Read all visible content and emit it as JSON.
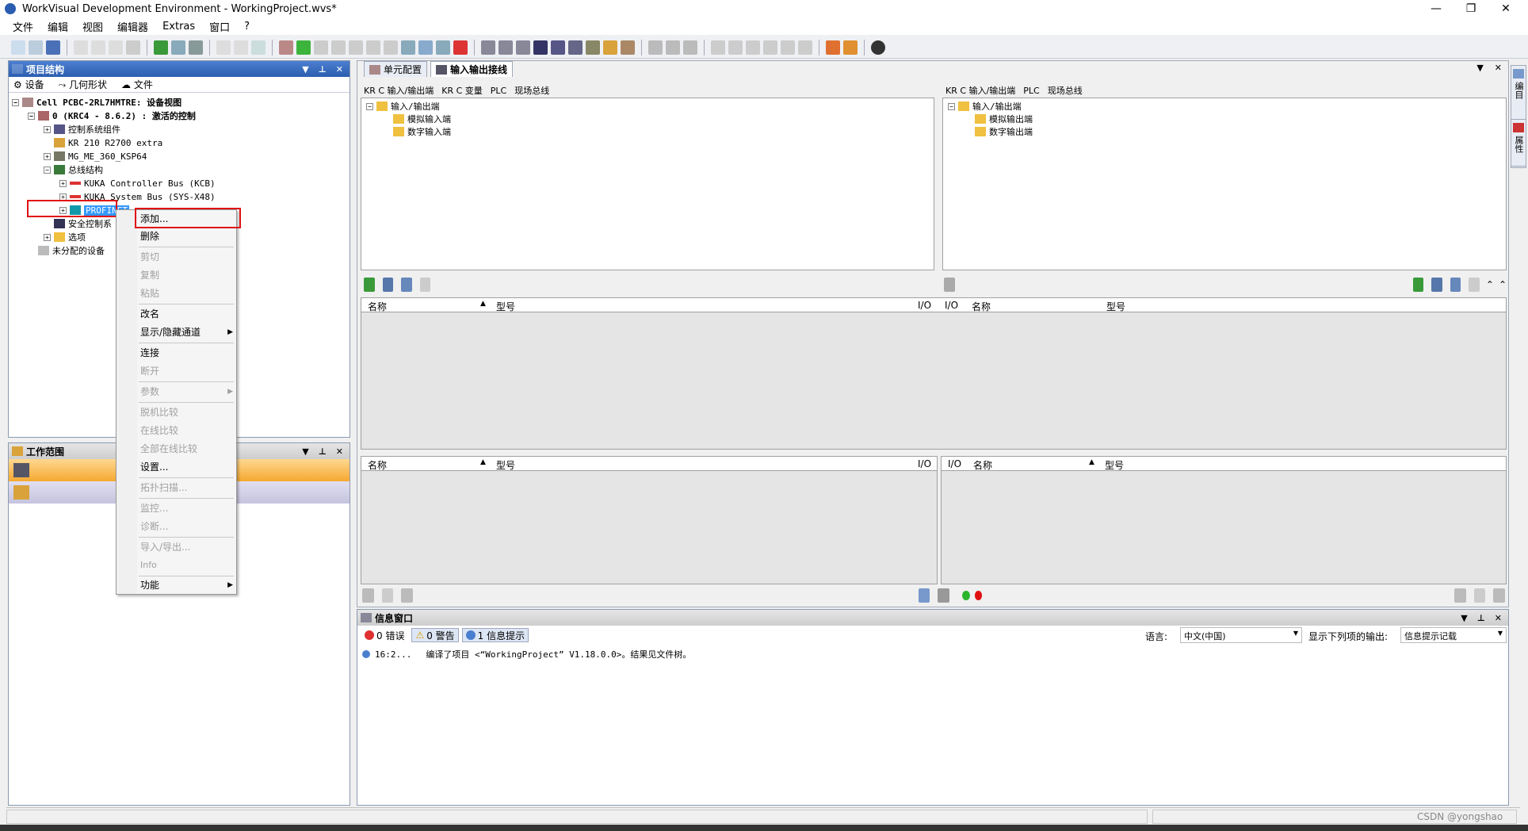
{
  "window": {
    "title": "WorkVisual Development Environment - WorkingProject.wvs*",
    "minimize": "—",
    "restore": "❐",
    "close": "✕"
  },
  "menu": [
    "文件",
    "编辑",
    "视图",
    "编辑器",
    "Extras",
    "窗口",
    "?"
  ],
  "project_panel": {
    "title": "项目结构",
    "tabs": [
      "设备",
      "几何形状",
      "文件"
    ],
    "tree": [
      "Cell PCBC-2RL7HMTRE: 设备视图",
      "0 (KRC4 - 8.6.2) : 激活的控制",
      "控制系统组件",
      "KR 210 R2700 extra",
      "MG_ME_360_KSP64",
      "总线结构",
      "KUKA Controller Bus (KCB)",
      "KUKA System Bus (SYS-X48)",
      "PROFINET",
      "安全控制系",
      "选项",
      "未分配的设备"
    ]
  },
  "work_panel": {
    "title": "工作范围"
  },
  "context_menu": {
    "items": [
      "添加...",
      "删除",
      "剪切",
      "复制",
      "粘贴",
      "改名",
      "显示/隐藏通道",
      "连接",
      "断开",
      "参数",
      "脱机比较",
      "在线比较",
      "全部在线比较",
      "设置...",
      "拓扑扫描...",
      "监控...",
      "诊断...",
      "导入/导出...",
      "Info",
      "功能"
    ]
  },
  "editor": {
    "tabs": [
      "单元配置",
      "输入输出接线"
    ],
    "left_subtabs": [
      "KR C 输入/输出端",
      "KR C 变量",
      "PLC",
      "现场总线"
    ],
    "right_subtabs": [
      "KR C 输入/输出端",
      "PLC",
      "现场总线"
    ],
    "left_tree": [
      "输入/输出端",
      "模拟输入端",
      "数字输入端"
    ],
    "right_tree": [
      "输入/输出端",
      "模拟输出端",
      "数字输出端"
    ],
    "grid_top": {
      "name": "名称",
      "type": "型号",
      "io1": "I/O",
      "io2": "I/O",
      "name2": "名称",
      "type2": "型号"
    },
    "grid_bl": {
      "name": "名称",
      "type": "型号",
      "io": "I/O"
    },
    "grid_br": {
      "io": "I/O",
      "name": "名称",
      "type": "型号"
    }
  },
  "info_panel": {
    "title": "信息窗口",
    "errors": "0 错误",
    "warnings": "0 警告",
    "infos": "1 信息提示",
    "lang_label": "语言:",
    "lang_value": "中文(中国)",
    "output_label": "显示下列项的输出:",
    "output_value": "信息提示记载",
    "messages": [
      {
        "time": "16:2...",
        "text": "编译了项目 <“WorkingProject” V1.18.0.0>。结果见文件树。"
      }
    ]
  },
  "side_tabs": [
    "编目",
    "属性"
  ],
  "watermark": "CSDN @yongshao"
}
